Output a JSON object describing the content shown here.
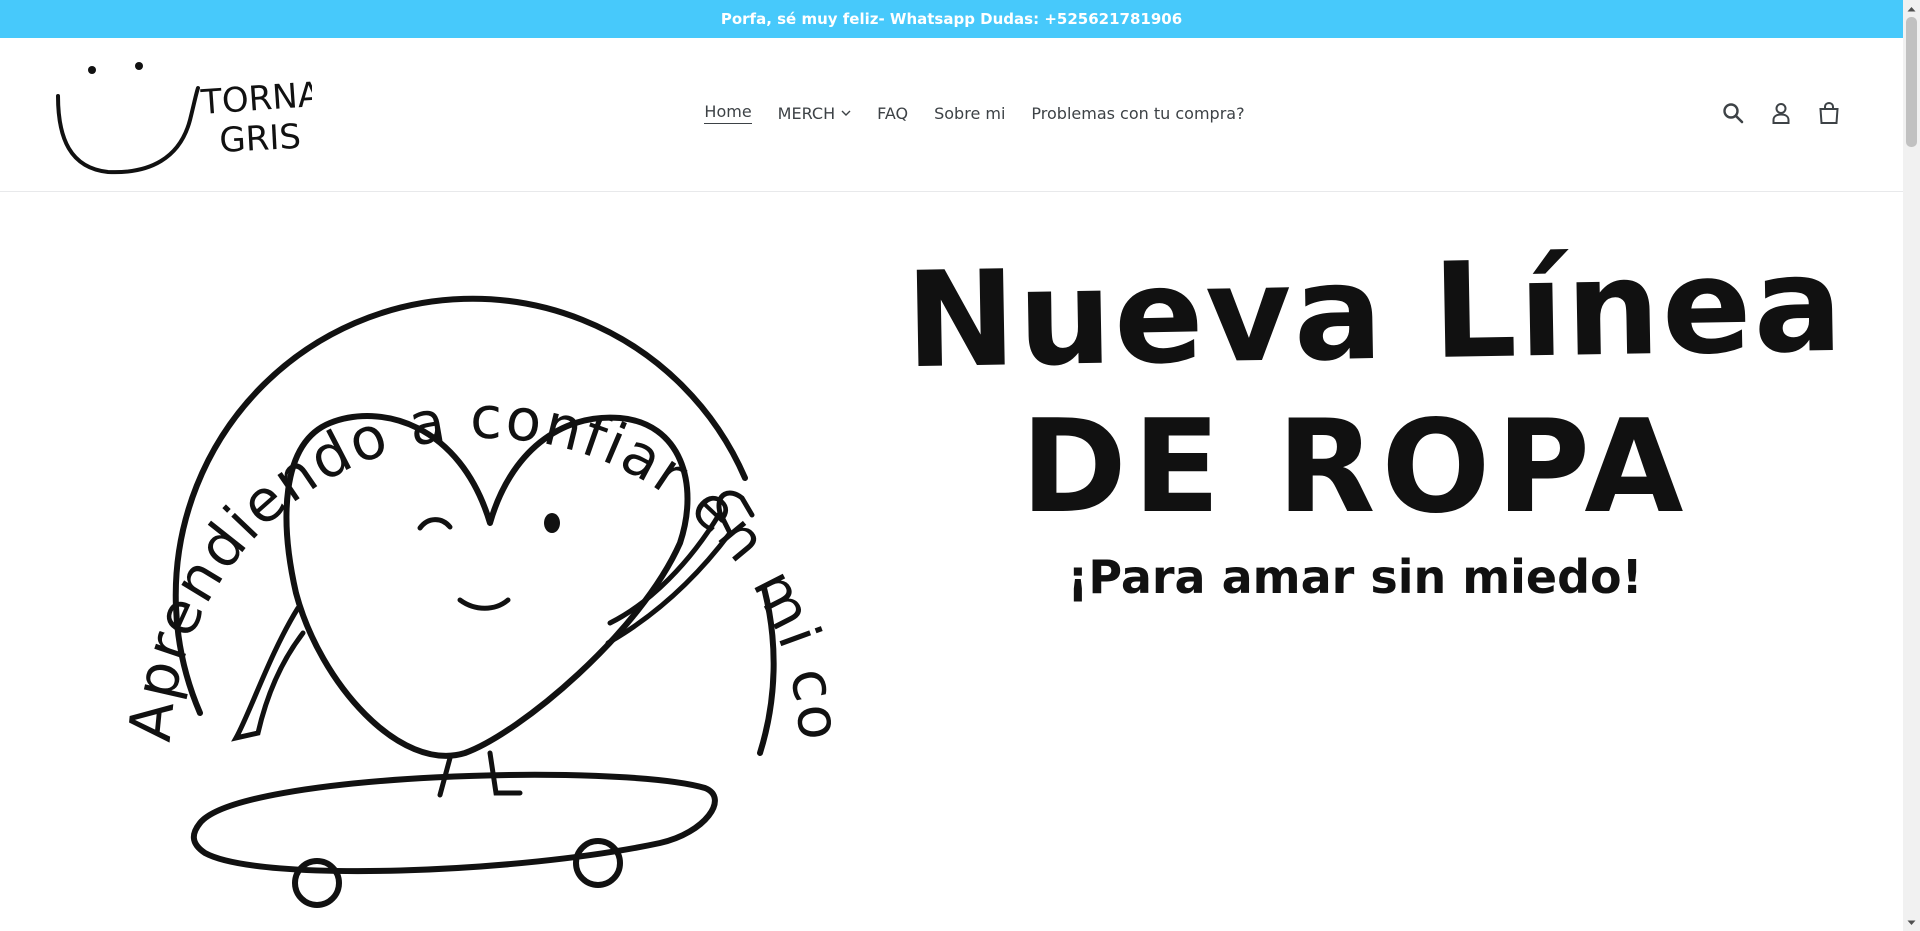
{
  "announcement": {
    "text": "Porfa, sé muy feliz- Whatsapp Dudas: +525621781906"
  },
  "brand": {
    "line1": "TORNA",
    "line2": "GRIS"
  },
  "nav": {
    "items": [
      {
        "label": "Home",
        "active": true
      },
      {
        "label": "MERCH",
        "dropdown": true
      },
      {
        "label": "FAQ"
      },
      {
        "label": "Sobre mi"
      },
      {
        "label": "Problemas con tu compra?"
      }
    ]
  },
  "header_icons": [
    "search-icon",
    "account-icon",
    "cart-icon"
  ],
  "hero": {
    "arc_text": "Aprendiendo a confiar en mi corazón",
    "headline_1": "Nueva Línea",
    "headline_2": "DE ROPA",
    "tagline": "¡Para amar sin miedo!"
  },
  "colors": {
    "announcement_bg": "#47c9fb",
    "text": "#3d4246",
    "ink": "#111111"
  }
}
